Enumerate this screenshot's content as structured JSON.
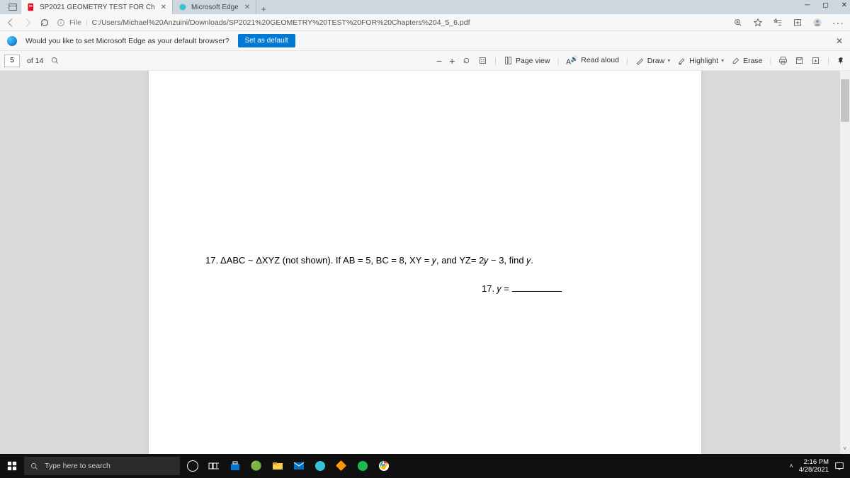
{
  "tabs": [
    {
      "title": "SP2021 GEOMETRY TEST FOR Ch",
      "active": true
    },
    {
      "title": "Microsoft Edge",
      "active": false
    }
  ],
  "address": {
    "scheme": "File",
    "path": "C:/Users/Michael%20Anzuini/Downloads/SP2021%20GEOMETRY%20TEST%20FOR%20Chapters%204_5_6.pdf"
  },
  "infobar": {
    "prompt": "Would you like to set Microsoft Edge as your default browser?",
    "button": "Set as default"
  },
  "pdf": {
    "page_current": "5",
    "page_total": "of 14",
    "tools": {
      "page_view": "Page view",
      "read_aloud": "Read aloud",
      "draw": "Draw",
      "highlight": "Highlight",
      "erase": "Erase"
    }
  },
  "document": {
    "question": "17. ΔABC ~ ΔXYZ (not shown).  If AB = 5, BC = 8, XY = 𝑦, and YZ= 2𝑦 − 3, find 𝑦.",
    "answer_label": "17. 𝑦 ="
  },
  "taskbar": {
    "search_placeholder": "Type here to search",
    "time": "2:16 PM",
    "date": "4/28/2021"
  }
}
